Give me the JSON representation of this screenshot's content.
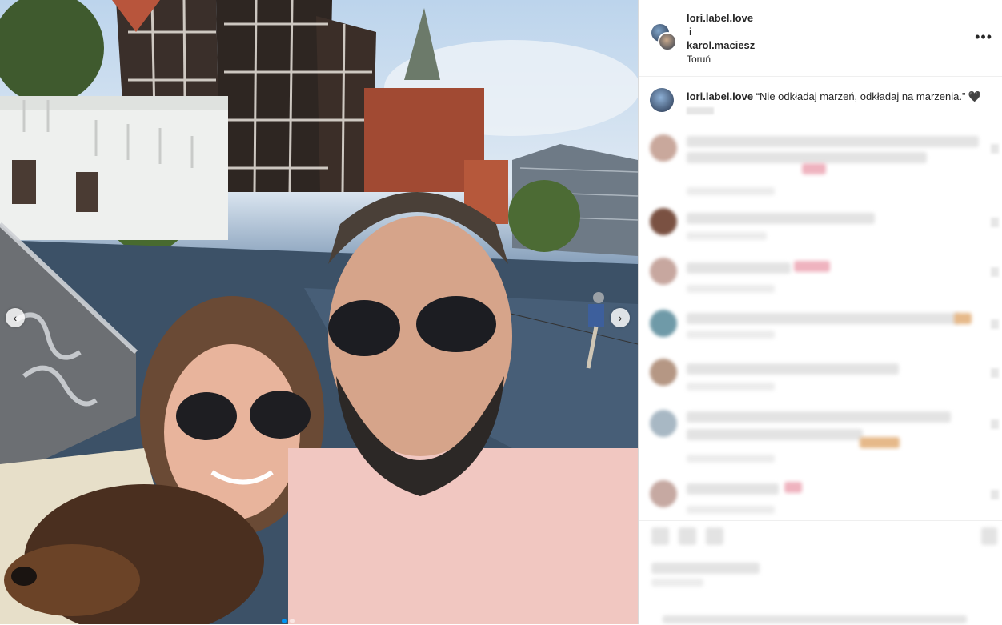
{
  "post": {
    "author": "lori.label.love",
    "conjunction": "i",
    "coauthor": "karol.maciesz",
    "location": "Toruń",
    "more_icon": "more-horizontal-icon"
  },
  "caption": {
    "username": "lori.label.love",
    "text": "“Nie odkładaj marzeń, odkładaj na marzenia.”",
    "emoji": "🖤"
  },
  "carousel": {
    "prev_glyph": "‹",
    "next_glyph": "›",
    "total_slides": 2,
    "active_slide": 1
  },
  "comments": {
    "count_visible": 8,
    "blurred": true
  }
}
